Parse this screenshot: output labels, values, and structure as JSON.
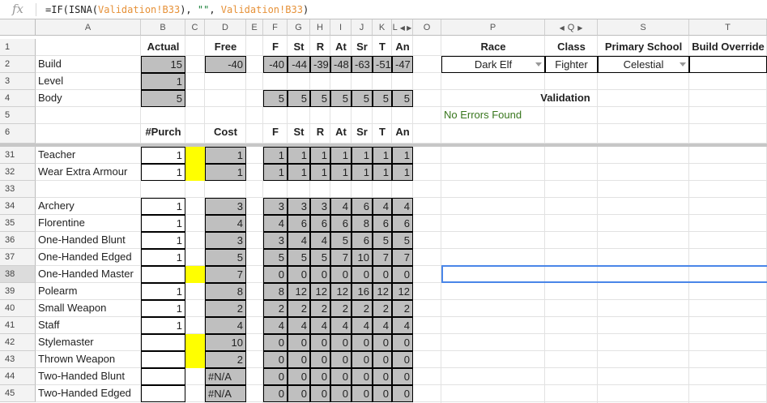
{
  "formula_bar": {
    "fx_label": "fx",
    "formula_parts": [
      {
        "text": "=IF(ISNA(",
        "kind": "plain"
      },
      {
        "text": "Validation!B33",
        "kind": "ref"
      },
      {
        "text": "), ",
        "kind": "plain"
      },
      {
        "text": "\"\"",
        "kind": "str"
      },
      {
        "text": ", ",
        "kind": "plain"
      },
      {
        "text": "Validation!B33",
        "kind": "ref"
      },
      {
        "text": ")",
        "kind": "plain"
      }
    ]
  },
  "column_headers": [
    "A",
    "B",
    "C",
    "D",
    "E",
    "F",
    "G",
    "H",
    "I",
    "J",
    "K",
    "L",
    "O",
    "P",
    "Q",
    "S",
    "T"
  ],
  "col_nav": {
    "left": "◀",
    "right": "▶"
  },
  "header_rows": [
    {
      "row": "1",
      "A": "",
      "B": "Actual",
      "C": "",
      "D": "Free",
      "F": "F",
      "G": "St",
      "H": "R",
      "I": "At",
      "J": "Sr",
      "K": "T",
      "L": "An",
      "P": "Race",
      "Q": "Class",
      "S": "Primary School",
      "T": "Build Override"
    },
    {
      "row": "2",
      "A": "Build",
      "B": "15",
      "C": "",
      "D": "-40",
      "F": "-40",
      "G": "-44",
      "H": "-39",
      "I": "-48",
      "J": "-63",
      "K": "-51",
      "L": "-47",
      "P": "Dark Elf",
      "Q": "Fighter",
      "S": "Celestial",
      "T": ""
    },
    {
      "row": "3",
      "A": "Level",
      "B": "1"
    },
    {
      "row": "4",
      "A": "Body",
      "B": "5",
      "F": "5",
      "G": "5",
      "H": "5",
      "I": "5",
      "J": "5",
      "K": "5",
      "L": "5",
      "P": "Validation"
    },
    {
      "row": "5",
      "P": "No Errors Found"
    },
    {
      "row": "6",
      "B": "#Purch",
      "D": "Cost",
      "F": "F",
      "G": "St",
      "H": "R",
      "I": "At",
      "J": "Sr",
      "K": "T",
      "L": "An"
    }
  ],
  "rows": [
    {
      "row": "31",
      "name": "Teacher",
      "purch": "1",
      "yellow": true,
      "cost": "1",
      "vals": [
        "1",
        "1",
        "1",
        "1",
        "1",
        "1",
        "1"
      ]
    },
    {
      "row": "32",
      "name": "Wear Extra Armour",
      "purch": "1",
      "yellow": true,
      "cost": "1",
      "vals": [
        "1",
        "1",
        "1",
        "1",
        "1",
        "1",
        "1"
      ]
    },
    {
      "row": "33",
      "name": "",
      "purch": null,
      "yellow": false,
      "cost": null,
      "vals": null
    },
    {
      "row": "34",
      "name": "Archery",
      "purch": "1",
      "yellow": false,
      "cost": "3",
      "vals": [
        "3",
        "3",
        "3",
        "4",
        "6",
        "4",
        "4"
      ]
    },
    {
      "row": "35",
      "name": "Florentine",
      "purch": "1",
      "yellow": false,
      "cost": "4",
      "vals": [
        "4",
        "6",
        "6",
        "6",
        "8",
        "6",
        "6"
      ]
    },
    {
      "row": "36",
      "name": "One-Handed Blunt",
      "purch": "1",
      "yellow": false,
      "cost": "3",
      "vals": [
        "3",
        "4",
        "4",
        "5",
        "6",
        "5",
        "5"
      ]
    },
    {
      "row": "37",
      "name": "One-Handed Edged",
      "purch": "1",
      "yellow": false,
      "cost": "5",
      "vals": [
        "5",
        "5",
        "5",
        "7",
        "10",
        "7",
        "7"
      ]
    },
    {
      "row": "38",
      "name": "One-Handed Master",
      "purch": "",
      "yellow": true,
      "cost": "7",
      "vals": [
        "0",
        "0",
        "0",
        "0",
        "0",
        "0",
        "0"
      ]
    },
    {
      "row": "39",
      "name": "Polearm",
      "purch": "1",
      "yellow": false,
      "cost": "8",
      "vals": [
        "8",
        "12",
        "12",
        "12",
        "16",
        "12",
        "12"
      ]
    },
    {
      "row": "40",
      "name": "Small Weapon",
      "purch": "1",
      "yellow": false,
      "cost": "2",
      "vals": [
        "2",
        "2",
        "2",
        "2",
        "2",
        "2",
        "2"
      ]
    },
    {
      "row": "41",
      "name": "Staff",
      "purch": "1",
      "yellow": false,
      "cost": "4",
      "vals": [
        "4",
        "4",
        "4",
        "4",
        "4",
        "4",
        "4"
      ]
    },
    {
      "row": "42",
      "name": "Stylemaster",
      "purch": "",
      "yellow": true,
      "cost": "10",
      "vals": [
        "0",
        "0",
        "0",
        "0",
        "0",
        "0",
        "0"
      ]
    },
    {
      "row": "43",
      "name": "Thrown Weapon",
      "purch": "",
      "yellow": true,
      "cost": "2",
      "vals": [
        "0",
        "0",
        "0",
        "0",
        "0",
        "0",
        "0"
      ]
    },
    {
      "row": "44",
      "name": "Two-Handed Blunt",
      "purch": "",
      "yellow": false,
      "cost": "#N/A",
      "vals": [
        "0",
        "0",
        "0",
        "0",
        "0",
        "0",
        "0"
      ]
    },
    {
      "row": "45",
      "name": "Two-Handed Edged",
      "purch": "",
      "yellow": false,
      "cost": "#N/A",
      "vals": [
        "0",
        "0",
        "0",
        "0",
        "0",
        "0",
        "0"
      ]
    }
  ],
  "selected_row": "38",
  "colors": {
    "gray_fill": "#bfbfbf",
    "yellow_fill": "#ffff00",
    "selection": "#4a86e8",
    "ok_text": "#38761d"
  }
}
